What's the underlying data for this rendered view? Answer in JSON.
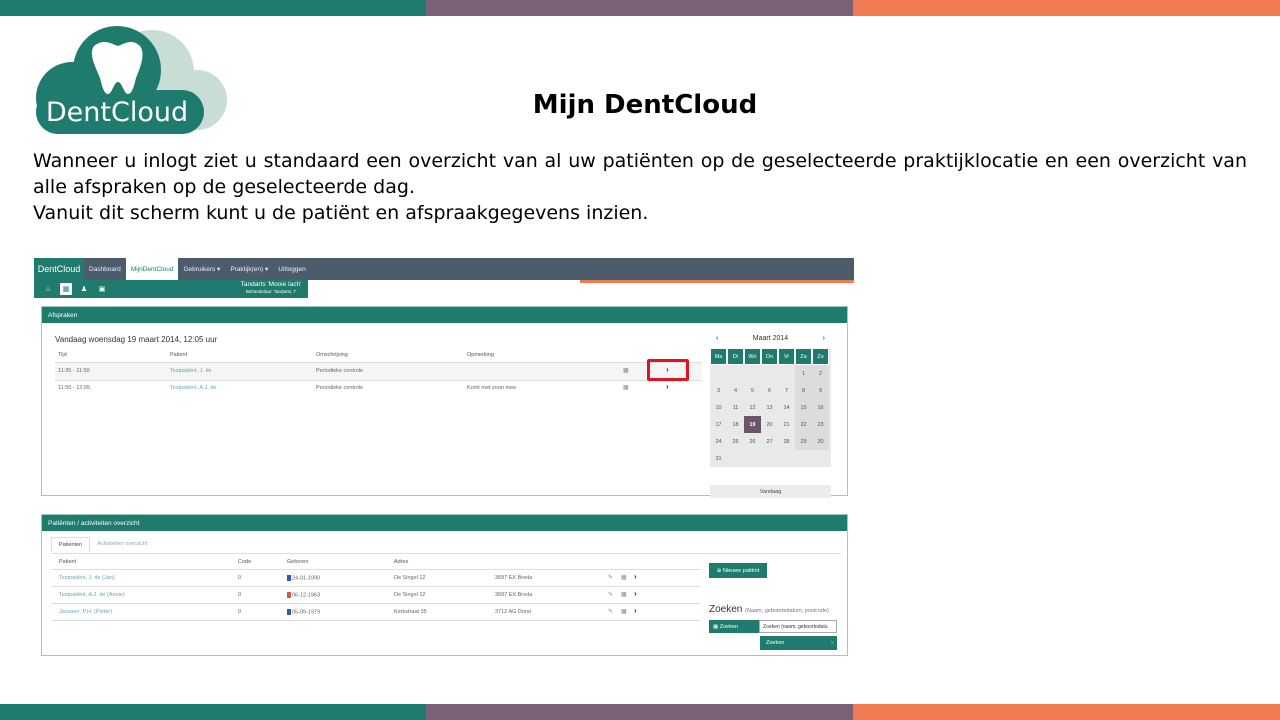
{
  "slide": {
    "title": "Mijn DentCloud",
    "paragraph1": "Wanneer u inlogt ziet u standaard een overzicht van al uw patiënten op de geselecteerde praktijklocatie en een overzicht van alle afspraken op de geselecteerde dag.",
    "paragraph2": "Vanuit dit scherm kunt u de patiënt en afspraakgegevens inzien.",
    "logo_text": "DentCloud"
  },
  "colors": {
    "teal": "#1e7b6d",
    "purple": "#7a6277",
    "orange": "#f17a52",
    "highlight": "#e0141e"
  },
  "app": {
    "brand": "DentCloud",
    "nav": [
      "Dashboard",
      "MijnDentCloud",
      "Gebruikers ▾",
      "Praktijk(en) ▾",
      "Uitloggen"
    ],
    "practice": {
      "name": "Tandarts 'Mooie lach'",
      "practitioner": "Behandelaar: Tandarts, T"
    },
    "toolbar_icons": [
      "home-icon",
      "calendar-icon",
      "user-icon",
      "card-icon"
    ],
    "appointments": {
      "header": "Afspraken",
      "date_line": "Vandaag woensdag 19 maart 2014, 12:05 uur",
      "columns": [
        "Tijd",
        "Patient",
        "Omschrijving",
        "Opmerking"
      ],
      "rows": [
        {
          "time": "11:35 - 11:50",
          "patient": "Testpatiënt, J. de",
          "description": "Periodieke controle",
          "remark": ""
        },
        {
          "time": "11:50 - 12:05",
          "patient": "Testpatiënt, A.J. de",
          "description": "Periodieke controle",
          "remark": "Komt met zoon mee"
        }
      ]
    },
    "calendar": {
      "month": "Maart 2014",
      "prev": "‹",
      "next": "›",
      "weekdays": [
        "Ma",
        "Di",
        "Wo",
        "Do",
        "Vr",
        "Za",
        "Zo"
      ],
      "days": [
        "",
        "",
        "",
        "",
        "",
        "1",
        "2",
        "3",
        "4",
        "5",
        "6",
        "7",
        "8",
        "9",
        "10",
        "11",
        "12",
        "13",
        "14",
        "15",
        "16",
        "17",
        "18",
        "19",
        "20",
        "21",
        "22",
        "23",
        "24",
        "25",
        "26",
        "27",
        "28",
        "29",
        "30",
        "31",
        "",
        "",
        "",
        "",
        "",
        ""
      ],
      "selected": "19",
      "today_button": "Vandaag"
    },
    "patients": {
      "header": "Patiënten / activiteiten overzicht",
      "tabs": [
        "Patienten",
        "Activiteiten overzicht"
      ],
      "columns": [
        "Patient",
        "Code",
        "Geboren",
        "Adres"
      ],
      "rows": [
        {
          "name": "Testpatiënt, J. de (Jan)",
          "code": "0",
          "gender": "male",
          "born": "24-01-1990",
          "street": "De Singel 12",
          "city": "3687 EX Breda"
        },
        {
          "name": "Testpatiënt, A.J. de (Annie)",
          "code": "0",
          "gender": "female",
          "born": "06-12-1963",
          "street": "De Singel 12",
          "city": "3687 EX Breda"
        },
        {
          "name": "Janssen, P.H. (Pieter)",
          "code": "0",
          "gender": "male",
          "born": "05-09-1979",
          "street": "Kerkstraat 35",
          "city": "3712 AG Dorst"
        }
      ],
      "new_patient": "⊕ Nieuwe patiënt",
      "search_title": "Zoeken",
      "search_hint": "(Naam, geboortedatum, postcode)",
      "search_label": "▦ Zoeken",
      "search_placeholder": "Zoeken (naam, geboortedatu",
      "search_button": "Zoeken"
    }
  }
}
